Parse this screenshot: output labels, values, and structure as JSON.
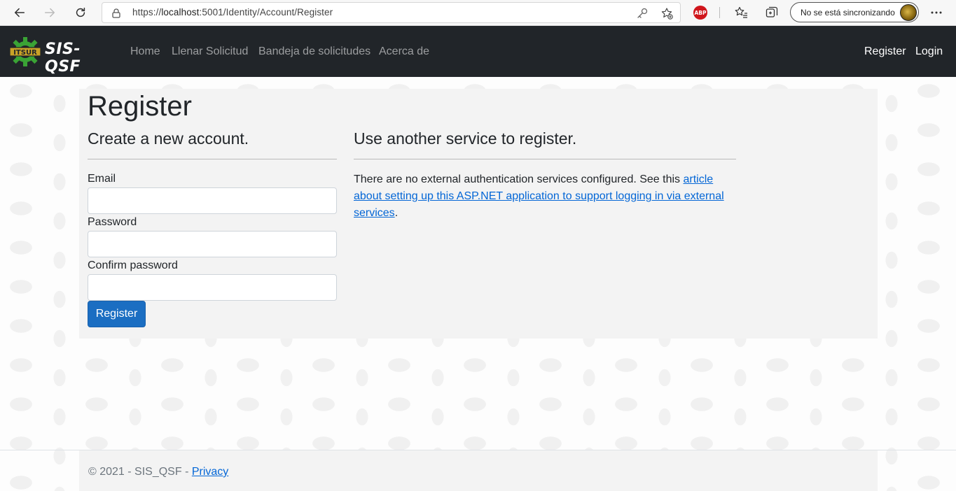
{
  "browser": {
    "url_scheme": "https://",
    "url_host": "localhost",
    "url_rest": ":5001/Identity/Account/Register",
    "abp_label": "ABP",
    "sync_label": "No se está sincronizando"
  },
  "navbar": {
    "brand": "SIS-QSF",
    "links": [
      "Home",
      "Llenar Solicitud",
      "Bandeja de solicitudes",
      "Acerca de"
    ],
    "register": "Register",
    "login": "Login",
    "background": "#212529"
  },
  "main": {
    "title": "Register",
    "form_heading": "Create a new account.",
    "email_label": "Email",
    "email_value": "",
    "password_label": "Password",
    "password_value": "",
    "confirm_label": "Confirm password",
    "confirm_value": "",
    "register_button": "Register",
    "external_heading": "Use another service to register.",
    "external_text": "There are no external authentication services configured. See this ",
    "external_link": "article about setting up this ASP.NET application to support logging in via external services",
    "external_end": "."
  },
  "footer": {
    "text": "© 2021 - SIS_QSF - ",
    "privacy": "Privacy"
  },
  "colors": {
    "primary": "#1b6ec2",
    "link": "#0366d6"
  }
}
